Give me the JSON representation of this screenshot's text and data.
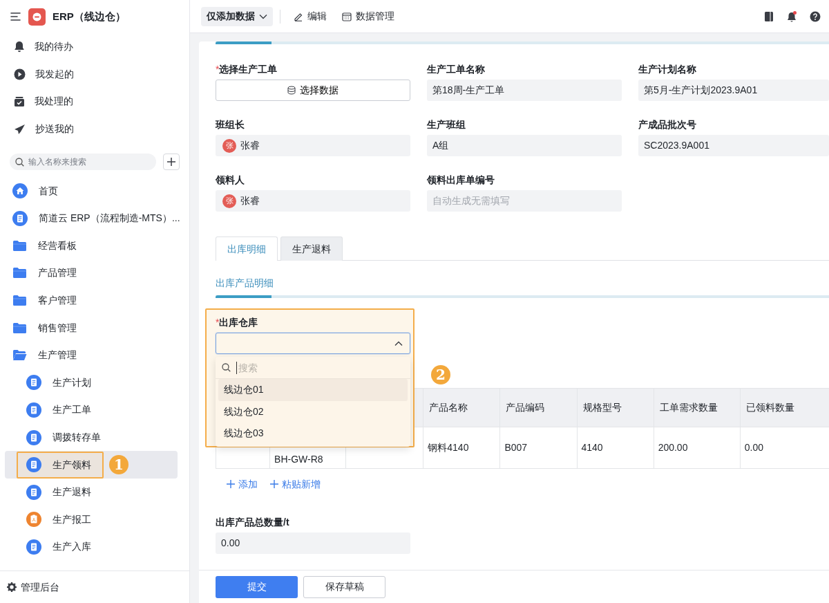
{
  "app": {
    "title": "ERP（线边仓）"
  },
  "sidebar": {
    "shortcuts": [
      {
        "label": "我的待办",
        "kind": "bell"
      },
      {
        "label": "我发起的",
        "kind": "play"
      },
      {
        "label": "我处理的",
        "kind": "inbox"
      },
      {
        "label": "抄送我的",
        "kind": "send"
      }
    ],
    "search": {
      "placeholder": "输入名称来搜索"
    },
    "items": [
      {
        "label": "首页",
        "kind": "home",
        "selected": false
      },
      {
        "label": "简道云 ERP（流程制造-MTS）...",
        "kind": "form",
        "selected": false
      },
      {
        "label": "经营看板",
        "kind": "folder",
        "expanded": false,
        "selected": false
      },
      {
        "label": "产品管理",
        "kind": "folder",
        "expanded": false,
        "selected": false
      },
      {
        "label": "客户管理",
        "kind": "folder",
        "expanded": false,
        "selected": false
      },
      {
        "label": "销售管理",
        "kind": "folder",
        "expanded": false,
        "selected": false
      },
      {
        "label": "生产管理",
        "kind": "folder",
        "expanded": true,
        "selected": false,
        "children": [
          {
            "label": "生产计划",
            "kind": "form",
            "selected": false
          },
          {
            "label": "生产工单",
            "kind": "form",
            "selected": false
          },
          {
            "label": "调拨转存单",
            "kind": "form",
            "selected": false
          },
          {
            "label": "生产领料",
            "kind": "form",
            "selected": true,
            "annotation": "1"
          },
          {
            "label": "生产退料",
            "kind": "form",
            "selected": false
          },
          {
            "label": "生产报工",
            "kind": "report",
            "selected": false
          },
          {
            "label": "生产入库",
            "kind": "form",
            "selected": false
          }
        ]
      }
    ],
    "footer": {
      "label": "管理后台"
    }
  },
  "toolbar": {
    "mode_button": "仅添加数据",
    "actions": [
      {
        "label": "编辑",
        "kind": "edit"
      },
      {
        "label": "数据管理",
        "kind": "table"
      }
    ],
    "notification_dot": true
  },
  "form": {
    "required_marker": "*",
    "fields": [
      {
        "label": "选择生产工单",
        "required": true,
        "kind": "picker",
        "value": "选择数据"
      },
      {
        "label": "生产工单名称",
        "required": false,
        "kind": "text",
        "value": "第18周-生产工单"
      },
      {
        "label": "生产计划名称",
        "required": false,
        "kind": "text",
        "value": "第5月-生产计划2023.9A01"
      },
      {
        "label": "班组长",
        "required": false,
        "kind": "user",
        "avatar": "张",
        "value": "张睿"
      },
      {
        "label": "生产班组",
        "required": false,
        "kind": "text",
        "value": "A组"
      },
      {
        "label": "产成品批次号",
        "required": false,
        "kind": "text",
        "value": "SC2023.9A001"
      },
      {
        "label": "领料人",
        "required": false,
        "kind": "user",
        "avatar": "张",
        "value": "张睿"
      },
      {
        "label": "领料出库单编号",
        "required": false,
        "kind": "text",
        "placeholder": "自动生成无需填写"
      }
    ],
    "tabs": [
      {
        "label": "出库明细",
        "selected": true
      },
      {
        "label": "生产退料",
        "selected": false
      }
    ],
    "section_title": "出库产品明细",
    "warehouse": {
      "label": "出库仓库",
      "required": true,
      "open": true,
      "annotation": "2",
      "search_placeholder": "搜索",
      "options": [
        {
          "label": "线边仓01",
          "highlighted": true
        },
        {
          "label": "线边仓02",
          "highlighted": false
        },
        {
          "label": "线边仓03",
          "highlighted": false
        }
      ]
    },
    "table": {
      "columns": [
        null,
        null,
        null,
        "产品名称",
        "产品编码",
        "规格型号",
        "工单需求数量",
        "已领料数量"
      ],
      "rows": [
        {
          "cells": [
            null,
            "BH-GW-R8",
            null,
            "钢料4140",
            "B007",
            "4140",
            "200.00",
            "0.00"
          ]
        }
      ]
    },
    "add_actions": [
      "添加",
      "粘贴新增"
    ],
    "total": {
      "label": "出库产品总数量/t",
      "value": "0.00"
    }
  },
  "footer_buttons": [
    {
      "label": "提交",
      "kind": "primary"
    },
    {
      "label": "保存草稿",
      "kind": "secondary"
    }
  ]
}
